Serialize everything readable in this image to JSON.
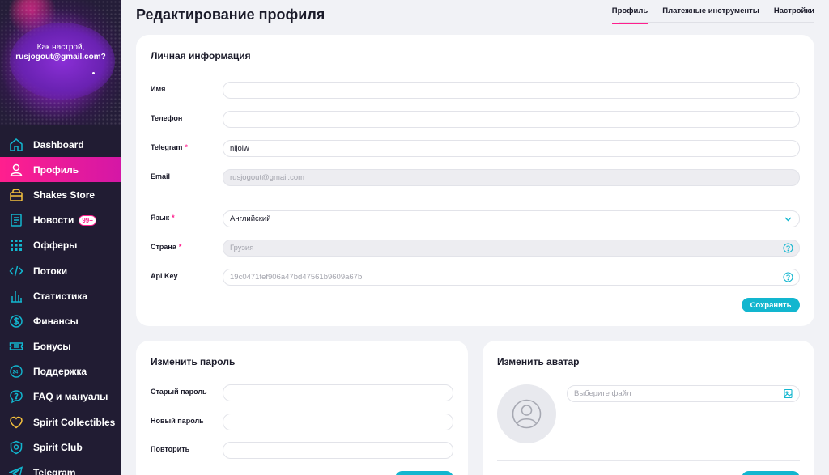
{
  "sidebar": {
    "user_line1": "Как настрой,",
    "user_line2": "rusjogout@gmail.com?",
    "items": [
      {
        "label": "Dashboard"
      },
      {
        "label": "Профиль"
      },
      {
        "label": "Shakes Store"
      },
      {
        "label": "Новости",
        "badge": "99+"
      },
      {
        "label": "Офферы"
      },
      {
        "label": "Потоки"
      },
      {
        "label": "Статистика"
      },
      {
        "label": "Финансы"
      },
      {
        "label": "Бонусы"
      },
      {
        "label": "Поддержка"
      },
      {
        "label": "FAQ и мануалы"
      },
      {
        "label": "Spirit Collectibles"
      },
      {
        "label": "Spirit Club"
      },
      {
        "label": "Telegram"
      }
    ]
  },
  "header": {
    "title": "Редактирование профиля",
    "tabs": [
      "Профиль",
      "Платежные инструменты",
      "Настройки"
    ]
  },
  "personal": {
    "title": "Личная информация",
    "name_label": "Имя",
    "name_value": "",
    "phone_label": "Телефон",
    "phone_value": "",
    "telegram_label": "Telegram",
    "telegram_value": "nljolw",
    "email_label": "Email",
    "email_value": "rusjogout@gmail.com",
    "language_label": "Язык",
    "language_value": "Английский",
    "country_label": "Страна",
    "country_value": "Грузия",
    "apikey_label": "Api Key",
    "apikey_value": "19c0471fef906a47bd47561b9609a67b",
    "required_mark": "*",
    "save_label": "Сохранить"
  },
  "password": {
    "title": "Изменить пароль",
    "old_label": "Старый пароль",
    "new_label": "Новый пароль",
    "repeat_label": "Повторить"
  },
  "avatar": {
    "title": "Изменить аватар",
    "file_placeholder": "Выберите файл"
  },
  "colors": {
    "accent_pink": "#ff1f8e",
    "accent_cyan": "#12b6cf",
    "sidebar_bg": "#211c33"
  }
}
